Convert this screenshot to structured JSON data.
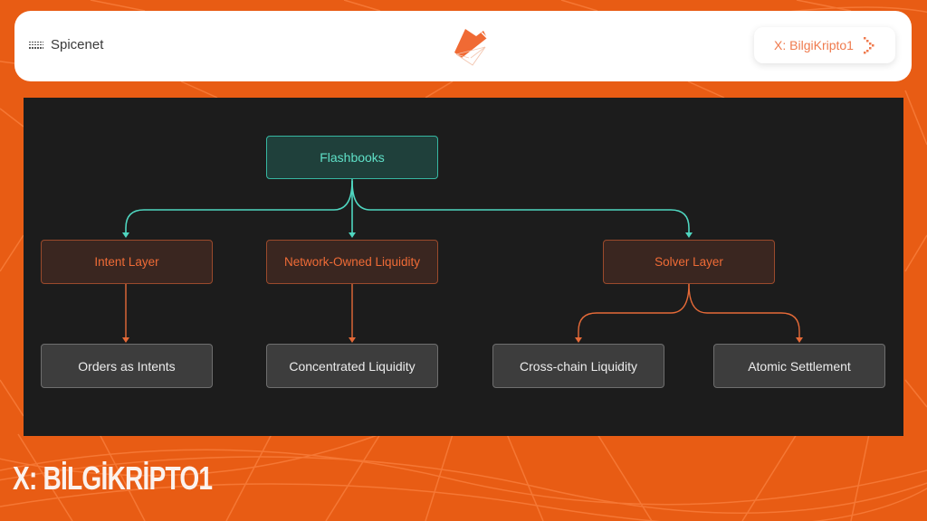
{
  "header": {
    "brand_icon": "dotted-menu-icon",
    "brand_name": "Spicenet",
    "logo_icon": "spicenet-envelope-logo",
    "handle_label": "X: BilgiKripto1",
    "handle_icon": "chevron-right-icon"
  },
  "colors": {
    "background": "#e85c14",
    "panel": "#1c1c1c",
    "root_accent": "#5fe0c7",
    "mid_accent": "#ef6b36",
    "leaf_text": "#ececec"
  },
  "diagram": {
    "root": {
      "label": "Flashbooks"
    },
    "layers": [
      {
        "label": "Intent Layer",
        "children": [
          "Orders as Intents"
        ]
      },
      {
        "label": "Network-Owned Liquidity",
        "children": [
          "Concentrated Liquidity"
        ]
      },
      {
        "label": "Solver Layer",
        "children": [
          "Cross-chain Liquidity",
          "Atomic Settlement"
        ]
      }
    ],
    "leaves": [
      "Orders as Intents",
      "Concentrated Liquidity",
      "Cross-chain Liquidity",
      "Atomic Settlement"
    ]
  },
  "watermark": "X: BİLGİKRİPTO1"
}
